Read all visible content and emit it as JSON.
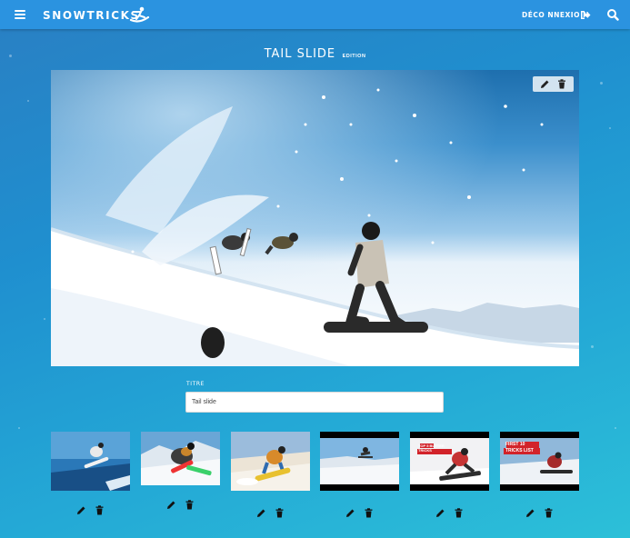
{
  "header": {
    "brand": "SNOWTRICKS",
    "logout_label": "DÉCO NNEXIO N",
    "icons": {
      "menu": "hamburger-icon",
      "logo": "snowboarder-logo",
      "logout": "logout-icon",
      "search": "search-icon"
    }
  },
  "page": {
    "title": "TAIL SLIDE",
    "subtitle": "EDITION"
  },
  "form": {
    "title_label": "TITRE",
    "title_value": "Tail slide"
  },
  "media": {
    "thumbnails": [
      {
        "kind": "image"
      },
      {
        "kind": "image"
      },
      {
        "kind": "image"
      },
      {
        "kind": "video"
      },
      {
        "kind": "video",
        "caption": "TOP 5 BUTTER TRICKS"
      },
      {
        "kind": "video",
        "caption": "FIRST 10 TRICKS LIST"
      }
    ]
  },
  "colors": {
    "navbar": "#2b93e0",
    "background_start": "#2a7fc3",
    "background_end": "#2cc0d8",
    "caption_red": "#d2232a"
  }
}
